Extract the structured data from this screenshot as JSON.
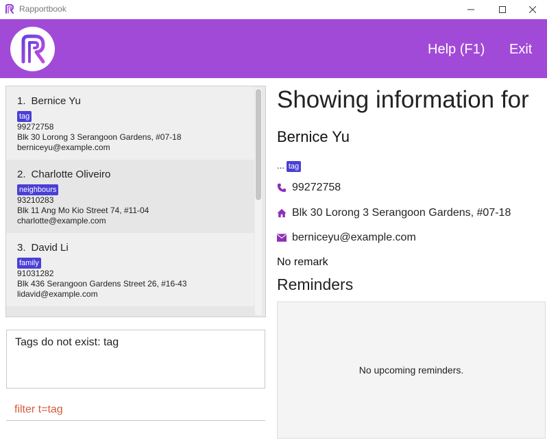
{
  "window": {
    "title": "Rapportbook"
  },
  "header": {
    "help_label": "Help (F1)",
    "exit_label": "Exit",
    "accent": "#a24ad8"
  },
  "persons": [
    {
      "index": "1.",
      "name": "Bernice Yu",
      "tag": "tag",
      "phone": "99272758",
      "address": "Blk 30 Lorong 3 Serangoon Gardens, #07-18",
      "email": "berniceyu@example.com"
    },
    {
      "index": "2.",
      "name": "Charlotte Oliveiro",
      "tag": "neighbours",
      "phone": "93210283",
      "address": "Blk 11 Ang Mo Kio Street 74, #11-04",
      "email": "charlotte@example.com"
    },
    {
      "index": "3.",
      "name": "David Li",
      "tag": "family",
      "phone": "91031282",
      "address": "Blk 436 Serangoon Gardens Street 26, #16-43",
      "email": "lidavid@example.com"
    }
  ],
  "result": {
    "message": "Tags do not exist: tag"
  },
  "command": {
    "text": "filter t=tag"
  },
  "detail": {
    "heading": "Showing information for",
    "name": "Bernice Yu",
    "tag_prefix": "...",
    "tag": "tag",
    "phone": "99272758",
    "address": "Blk 30 Lorong 3 Serangoon Gardens, #07-18",
    "email": "berniceyu@example.com",
    "remark": "No remark",
    "reminders_heading": "Reminders",
    "reminders_empty": "No upcoming reminders."
  },
  "colors": {
    "tag_bg": "#4a3fd6",
    "command_text": "#d55b3b",
    "icon": "#8e2fb5"
  },
  "icons": {
    "phone": "phone-icon",
    "address": "home-icon",
    "email": "envelope-icon"
  }
}
